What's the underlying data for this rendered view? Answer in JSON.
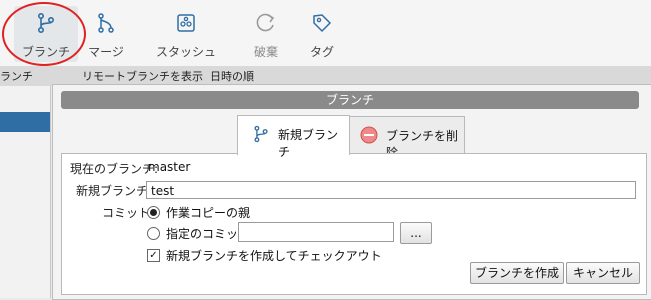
{
  "toolbar": {
    "items": [
      {
        "label": "ブランチ",
        "icon": "branch-icon"
      },
      {
        "label": "マージ",
        "icon": "merge-icon"
      },
      {
        "label": "スタッシュ",
        "icon": "stash-icon"
      },
      {
        "label": "破棄",
        "icon": "discard-icon"
      },
      {
        "label": "タグ",
        "icon": "tag-icon"
      }
    ]
  },
  "background": {
    "branch_label": "ランチ",
    "remote_checkbox": "リモートブランチを表示",
    "sort_label": "日時の順"
  },
  "dialog": {
    "title": "ブランチ",
    "tabs": [
      {
        "label": "新規ブランチ",
        "icon": "branch-icon"
      },
      {
        "label": "ブランチを削除",
        "icon": "delete-icon"
      }
    ],
    "current_branch_label": "現在のブランチ:",
    "current_branch_value": "master",
    "new_branch_label": "新規ブランチ:",
    "new_branch_value": "test",
    "commit_label": "コミット:",
    "radio_working_copy": "作業コピーの親",
    "radio_specified": "指定のコミット:",
    "specified_commit_value": "",
    "browse_button": "...",
    "checkout_checkbox": "新規ブランチを作成してチェックアウト",
    "create_button": "ブランチを作成",
    "cancel_button": "キャンセル"
  },
  "colors": {
    "accent": "#2f6ea5",
    "annotation_circle": "#e02222"
  }
}
